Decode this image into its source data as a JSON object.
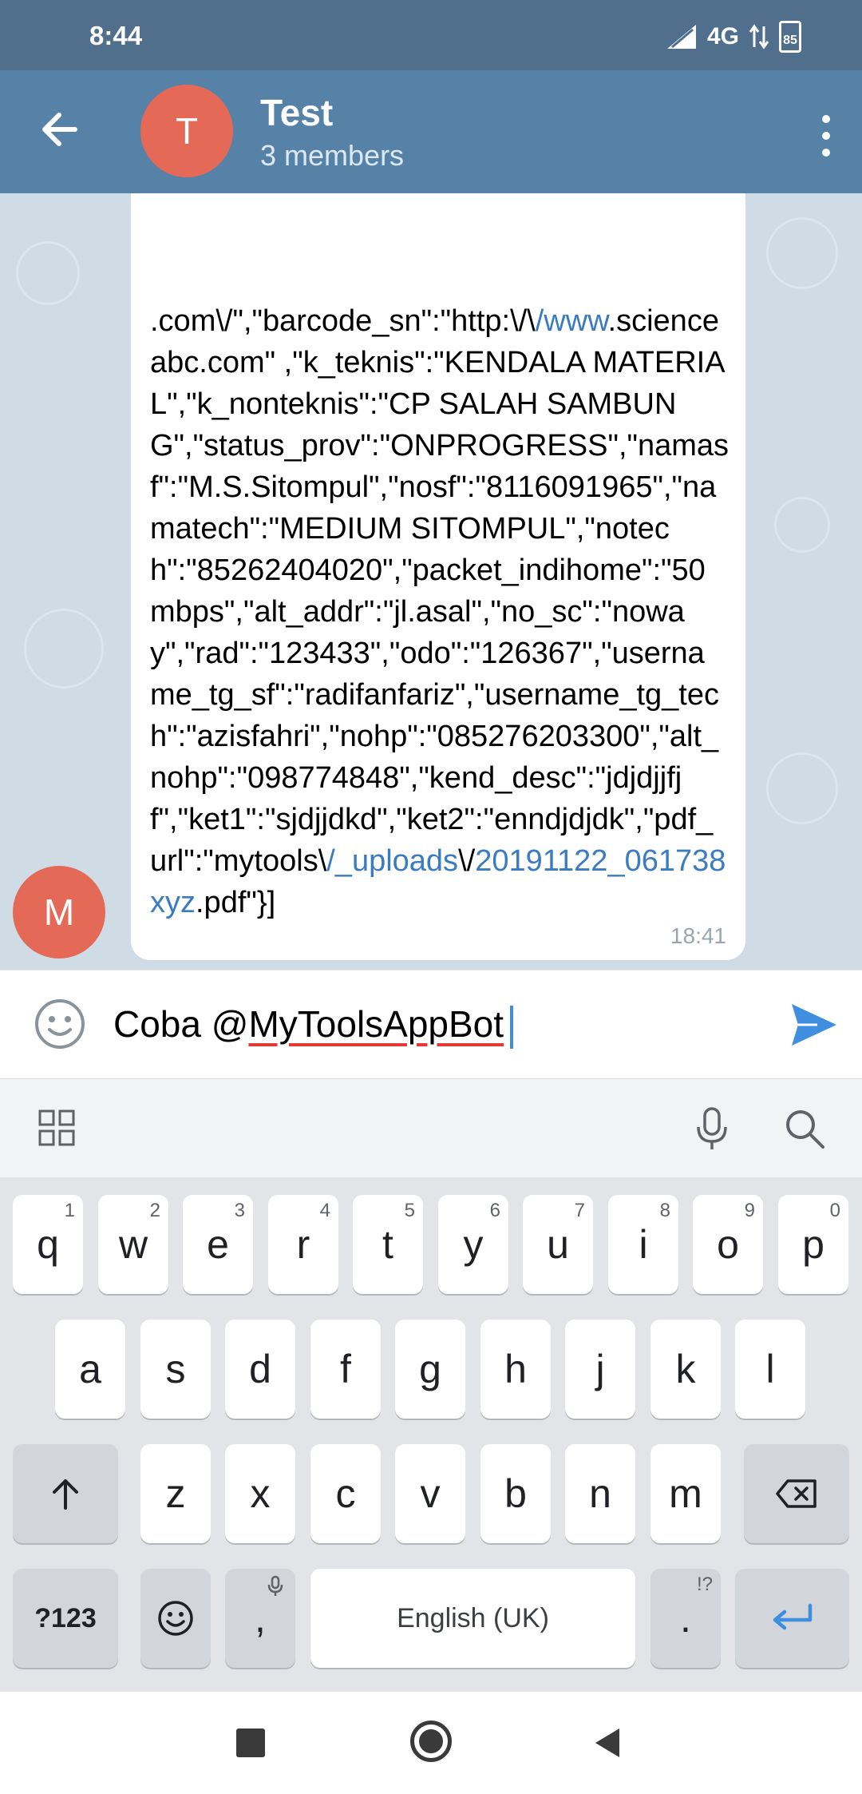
{
  "status_bar": {
    "time": "8:44",
    "network": "4G",
    "battery": "85"
  },
  "header": {
    "avatar_letter": "T",
    "title": "Test",
    "subtitle": "3 members"
  },
  "message": {
    "sender_avatar_letter": "M",
    "text_part1": ".com\\/\",\"barcode_sn\":\"http:\\/\\",
    "link1": "/www",
    "text_part2": ".scienceabc.com\" ,\"k_teknis\":\"KENDALA MATERIAL\",\"k_nonteknis\":\"CP SALAH SAMBUNG\",\"status_prov\":\"ONPROGRESS\",\"namasf\":\"M.S.Sitompul\",\"nosf\":\"8116091965\",\"namatech\":\"MEDIUM SITOMPUL\",\"notech\":\"85262404020\",\"packet_indihome\":\"50 mbps\",\"alt_addr\":\"jl.asal\",\"no_sc\":\"noway\",\"rad\":\"123433\",\"odo\":\"126367\",\"username_tg_sf\":\"radifanfariz\",\"username_tg_tech\":\"azisfahri\",\"nohp\":\"085276203300\",\"alt_nohp\":\"098774848\",\"kend_desc\":\"jdjdjjfjf\",\"ket1\":\"sjdjjdkd\",\"ket2\":\"enndjdjdk\",\"pdf_url\":\"mytools\\",
    "link2": "/_uploads",
    "text_part3": "\\/",
    "link3": "20191122_061738xyz",
    "text_part4": ".pdf\"}]",
    "time": "18:41"
  },
  "input": {
    "prefix": "Coba @",
    "mention": "MyToolsAppBot"
  },
  "keyboard": {
    "row1": [
      {
        "k": "q",
        "h": "1"
      },
      {
        "k": "w",
        "h": "2"
      },
      {
        "k": "e",
        "h": "3"
      },
      {
        "k": "r",
        "h": "4"
      },
      {
        "k": "t",
        "h": "5"
      },
      {
        "k": "y",
        "h": "6"
      },
      {
        "k": "u",
        "h": "7"
      },
      {
        "k": "i",
        "h": "8"
      },
      {
        "k": "o",
        "h": "9"
      },
      {
        "k": "p",
        "h": "0"
      }
    ],
    "row2": [
      "a",
      "s",
      "d",
      "f",
      "g",
      "h",
      "j",
      "k",
      "l"
    ],
    "row3": [
      "z",
      "x",
      "c",
      "v",
      "b",
      "n",
      "m"
    ],
    "symbols_label": "?123",
    "comma_label": ",",
    "space_label": "English (UK)",
    "period_label": ".",
    "period_hint": "!?"
  },
  "colors": {
    "header": "#5682a8",
    "status": "#4f6f8c",
    "avatar": "#e46a57",
    "link": "#3a7bc1",
    "accent": "#3f8ee0"
  }
}
